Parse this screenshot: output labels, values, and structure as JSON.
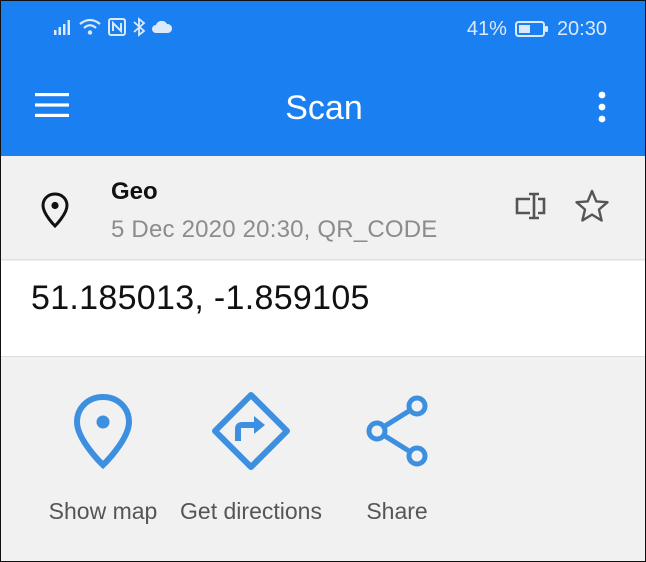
{
  "status_bar": {
    "battery_percent": "41%",
    "time": "20:30",
    "left_icons": [
      "signal-icon",
      "wifi-icon",
      "nfc-icon",
      "bluetooth-icon",
      "cloud-icon"
    ]
  },
  "toolbar": {
    "title": "Scan",
    "menu_icon": "hamburger-menu-icon",
    "more_icon": "more-vertical-icon"
  },
  "result": {
    "type": "Geo",
    "meta": "5 Dec 2020 20:30, QR_CODE",
    "value": "51.185013, -1.859105",
    "type_icon": "location-pin-icon",
    "edit_icon": "edit-text-icon",
    "favorite_icon": "star-icon"
  },
  "actions": [
    {
      "label": "Show map",
      "icon": "map-pin-icon"
    },
    {
      "label": "Get directions",
      "icon": "directions-icon"
    },
    {
      "label": "Share",
      "icon": "share-icon"
    }
  ],
  "colors": {
    "primary": "#1a7ff0",
    "action_icon": "#3d8fe0",
    "background": "#f1f1f1"
  }
}
